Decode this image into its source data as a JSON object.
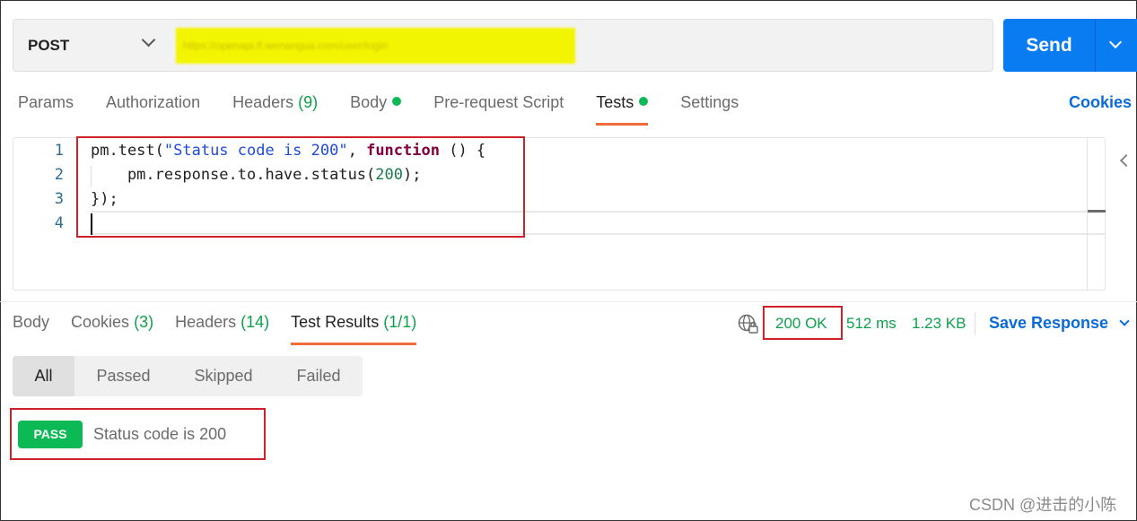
{
  "request": {
    "method": "POST",
    "url": "https://openapi.fl.wenangua.com/user/login",
    "send_label": "Send"
  },
  "request_tabs": [
    {
      "label": "Params",
      "count": "",
      "dot": false,
      "active": false
    },
    {
      "label": "Authorization",
      "count": "",
      "dot": false,
      "active": false
    },
    {
      "label": "Headers",
      "count": "(9)",
      "dot": false,
      "active": false
    },
    {
      "label": "Body",
      "count": "",
      "dot": true,
      "active": false
    },
    {
      "label": "Pre-request Script",
      "count": "",
      "dot": false,
      "active": false
    },
    {
      "label": "Tests",
      "count": "",
      "dot": true,
      "active": true
    },
    {
      "label": "Settings",
      "count": "",
      "dot": false,
      "active": false
    }
  ],
  "cookies_label": "Cookies",
  "editor": {
    "line_numbers": [
      "1",
      "2",
      "3",
      "4"
    ],
    "lines": [
      [
        {
          "t": "pm.test(",
          "c": ""
        },
        {
          "t": "\"Status code is 200\"",
          "c": "str"
        },
        {
          "t": ", ",
          "c": ""
        },
        {
          "t": "function",
          "c": "kw"
        },
        {
          "t": " () {",
          "c": ""
        }
      ],
      [
        {
          "t": "    pm.response.to.have.status(",
          "c": ""
        },
        {
          "t": "200",
          "c": "num"
        },
        {
          "t": ");",
          "c": ""
        }
      ],
      [
        {
          "t": "});",
          "c": ""
        }
      ],
      []
    ]
  },
  "response_tabs": [
    {
      "label": "Body",
      "count": "",
      "active": false
    },
    {
      "label": "Cookies",
      "count": "(3)",
      "active": false
    },
    {
      "label": "Headers",
      "count": "(14)",
      "active": false
    },
    {
      "label": "Test Results",
      "count": "(1/1)",
      "active": true
    }
  ],
  "response_meta": {
    "status": "200 OK",
    "time": "512 ms",
    "size": "1.23 KB",
    "save_label": "Save Response",
    "colors": {
      "success": "#0e9f4b",
      "link": "#0a6bd6",
      "accent": "#f26b3a"
    }
  },
  "filters": [
    {
      "label": "All",
      "active": true
    },
    {
      "label": "Passed",
      "active": false
    },
    {
      "label": "Skipped",
      "active": false
    },
    {
      "label": "Failed",
      "active": false
    }
  ],
  "results": [
    {
      "badge": "PASS",
      "name": "Status code is 200"
    }
  ],
  "watermark": "CSDN @进击的小陈"
}
